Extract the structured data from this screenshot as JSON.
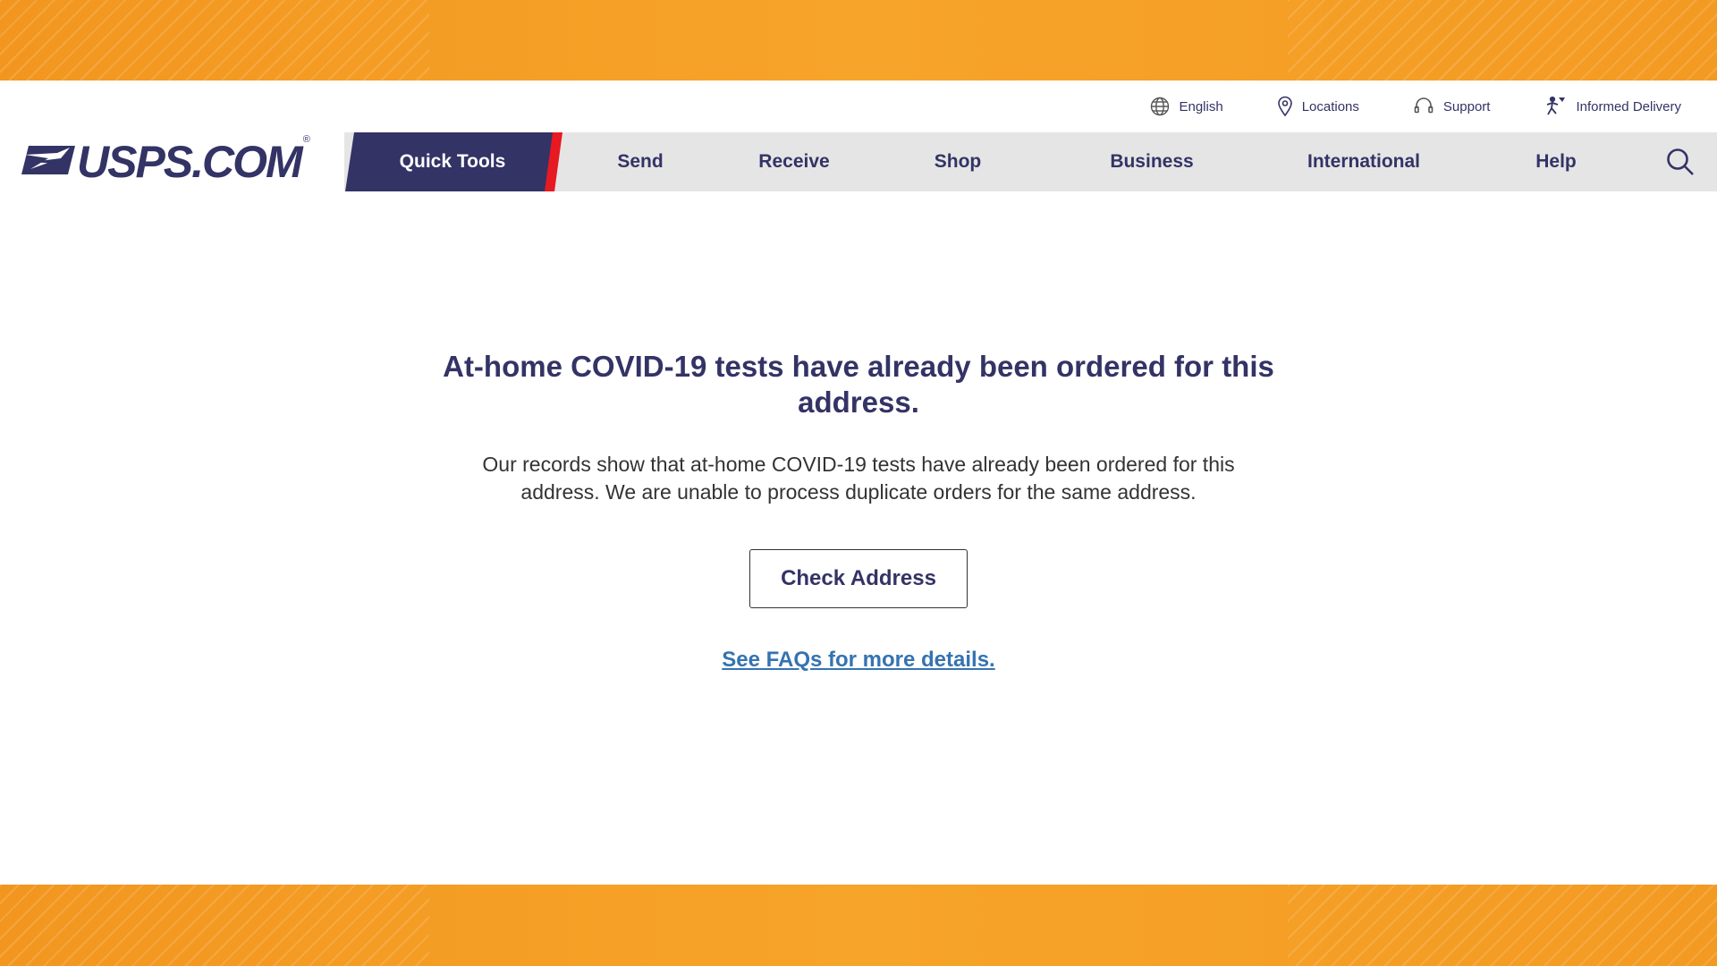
{
  "utility_nav": {
    "items": [
      {
        "label": "English",
        "icon": "globe-icon"
      },
      {
        "label": "Locations",
        "icon": "location-pin-icon"
      },
      {
        "label": "Support",
        "icon": "headset-icon"
      },
      {
        "label": "Informed Delivery",
        "icon": "informed-delivery-icon"
      }
    ]
  },
  "logo": {
    "text": "USPS.COM",
    "registered": "®"
  },
  "main_nav": {
    "items": [
      "Quick Tools",
      "Send",
      "Receive",
      "Shop",
      "Business",
      "International",
      "Help"
    ],
    "search_icon": "search-icon"
  },
  "message": {
    "headline": "At-home COVID-19 tests have already been ordered for this address.",
    "body": "Our records show that at-home COVID-19 tests have already been ordered for this address. We are unable to process duplicate orders for the same address.",
    "button_label": "Check Address",
    "faq_link": "See FAQs for more details."
  },
  "colors": {
    "brand_navy": "#333366",
    "brand_red": "#e71921",
    "link_blue": "#3573b1",
    "frame_orange": "#f5a023"
  }
}
